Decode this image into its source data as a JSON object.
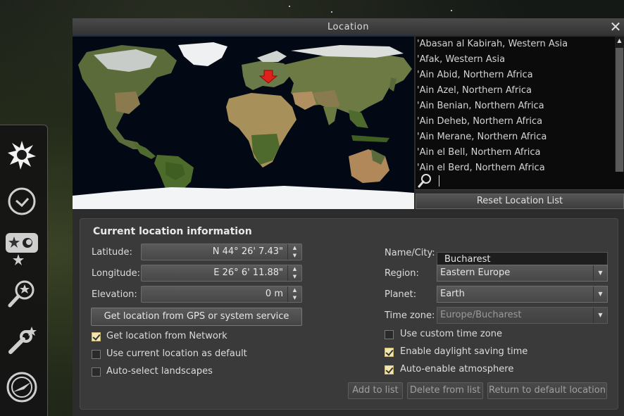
{
  "window": {
    "title": "Location",
    "close_icon": "close-icon"
  },
  "sidebar": {
    "items": [
      {
        "name": "sun-icon"
      },
      {
        "name": "clock-icon"
      },
      {
        "name": "sky-view-icon"
      },
      {
        "name": "search-icon"
      },
      {
        "name": "wrench-icon"
      },
      {
        "name": "compass-icon"
      }
    ]
  },
  "cities": [
    "'Abasan al Kabirah, Western Asia",
    "'Afak, Western Asia",
    "'Ain Abid, Northern Africa",
    "'Ain Azel, Northern Africa",
    "'Ain Benian, Northern Africa",
    "'Ain Deheb, Northern Africa",
    "'Ain Merane, Northern Africa",
    "'Ain el Bell, Northern Africa",
    "'Ain el Berd, Northern Africa"
  ],
  "search": {
    "value": ""
  },
  "reset_label": "Reset Location List",
  "info": {
    "title": "Current location information",
    "latitude_label": "Latitude:",
    "latitude_value": "N 44° 26' 7.43\"",
    "longitude_label": "Longitude:",
    "longitude_value": "E 26° 6' 11.88\"",
    "elevation_label": "Elevation:",
    "elevation_value": "0 m",
    "gps_button": "Get location from GPS or system service",
    "network_label": "Get location from Network",
    "network_checked": true,
    "default_label": "Use current location as default",
    "default_checked": false,
    "landscapes_label": "Auto-select landscapes",
    "landscapes_checked": false,
    "name_label": "Name/City:",
    "name_value": "Bucharest",
    "region_label": "Region:",
    "region_value": "Eastern Europe",
    "planet_label": "Planet:",
    "planet_value": "Earth",
    "timezone_label": "Time zone:",
    "timezone_value": "Europe/Bucharest",
    "custom_tz_label": "Use custom time zone",
    "custom_tz_checked": false,
    "dst_label": "Enable daylight saving time",
    "dst_checked": true,
    "atmosphere_label": "Auto-enable atmosphere",
    "atmosphere_checked": true,
    "add_button": "Add to list",
    "delete_button": "Delete from list",
    "return_button": "Return to default location"
  },
  "colors": {
    "accent_check": "#f2e6b0",
    "marker": "#e0201a"
  }
}
